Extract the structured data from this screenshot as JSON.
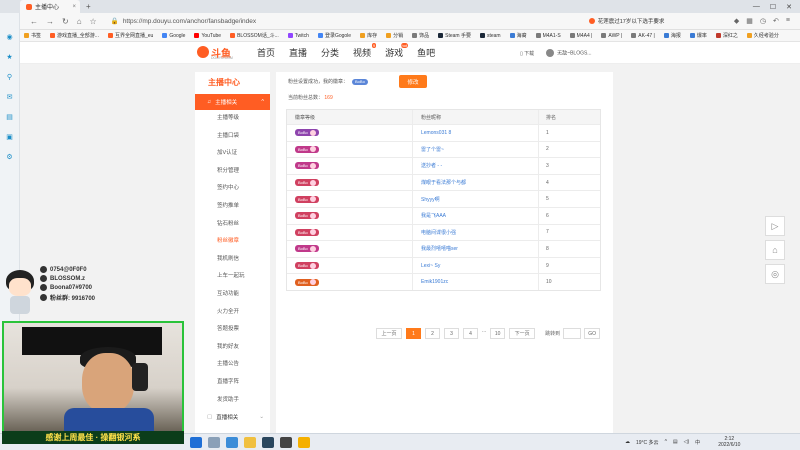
{
  "browser": {
    "tab_title": "主播中心",
    "url": "https://mp.douyu.com/anchor/fansbadge/index",
    "hot_text": "花莲震过17岁以下选手要求",
    "bookmarks": [
      {
        "label": "书签",
        "color": "#f0a020"
      },
      {
        "label": "游戏直播_全部游...",
        "color": "#ff5d23"
      },
      {
        "label": "互界全网直播_eu",
        "color": "#ff5d23"
      },
      {
        "label": "Google",
        "color": "#4285f4"
      },
      {
        "label": "YouTube",
        "color": "#ff0000"
      },
      {
        "label": "BLOSSOM话_斗...",
        "color": "#ff5d23"
      },
      {
        "label": "Twitch",
        "color": "#9146ff"
      },
      {
        "label": "登录Gogole",
        "color": "#4285f4"
      },
      {
        "label": "库存",
        "color": "#f0a020"
      },
      {
        "label": "分销",
        "color": "#f0a020"
      },
      {
        "label": "饰品",
        "color": "#7a7a7a"
      },
      {
        "label": "Steam 手要",
        "color": "#1b2838"
      },
      {
        "label": "steam",
        "color": "#1b2838"
      },
      {
        "label": "海裔",
        "color": "#3a7bd5"
      },
      {
        "label": "M4A1-S",
        "color": "#7a7a7a"
      },
      {
        "label": "M4A4 |",
        "color": "#7a7a7a"
      },
      {
        "label": "AWP |",
        "color": "#7a7a7a"
      },
      {
        "label": "AK-47 |",
        "color": "#7a7a7a"
      },
      {
        "label": "海报",
        "color": "#3a7bd5"
      },
      {
        "label": "爆率",
        "color": "#3a7bd5"
      },
      {
        "label": "深红之",
        "color": "#c0392b"
      },
      {
        "label": "久经考验分",
        "color": "#f0a020"
      }
    ]
  },
  "site": {
    "logo_text": "斗鱼",
    "logo_sub": "DOUYU.COM",
    "nav": [
      {
        "label": "首页",
        "badge": ""
      },
      {
        "label": "直播",
        "badge": ""
      },
      {
        "label": "分类",
        "badge": ""
      },
      {
        "label": "视频",
        "badge": "9"
      },
      {
        "label": "游戏",
        "badge": "hot"
      },
      {
        "label": "鱼吧",
        "badge": ""
      }
    ],
    "download": "下载",
    "user_name": "无敌~BLOGS..."
  },
  "sidebar": {
    "title": "主播中心",
    "active_group": "主播相关",
    "items": [
      "主播等级",
      "主播口袋",
      "加V认证",
      "积分管理",
      "签约中心",
      "签约推单",
      "钻石粉丝",
      "粉丝徽章",
      "我机刷信",
      "上车一起玩",
      "互动功能",
      "火力全开",
      "答题投票",
      "我的好友",
      "主播公告",
      "直播字阵",
      "发货助手"
    ],
    "current_index": 7,
    "group2": "直播相关"
  },
  "content": {
    "badge_prefix": "粉丝设置成功，我的徽章：",
    "my_badge": "BoBo",
    "edit_button": "修改",
    "fan_total_label": "当前粉丝总数：",
    "fan_total": "169",
    "table": {
      "headers": [
        "徽章等级",
        "粉丝昵称",
        "排名"
      ],
      "rows": [
        {
          "badge": "BoBo",
          "level": 23,
          "color": "#8e44ad",
          "name": "Lemons031 8",
          "rank": "1"
        },
        {
          "badge": "BoBo",
          "level": 21,
          "color": "#c0398a",
          "name": "雷了个雷~",
          "rank": "2"
        },
        {
          "badge": "BoBo",
          "level": 19,
          "color": "#c0398a",
          "name": "送抄者 - -",
          "rank": "3"
        },
        {
          "badge": "BoBo",
          "level": 18,
          "color": "#d04060",
          "name": "煤眼于看法那个与都",
          "rank": "4"
        },
        {
          "badge": "BoBo",
          "level": 16,
          "color": "#d04060",
          "name": "Shyyy啊",
          "rank": "5"
        },
        {
          "badge": "BoBo",
          "level": 15,
          "color": "#d04060",
          "name": "我是飞AAA",
          "rank": "6"
        },
        {
          "badge": "BoBo",
          "level": 15,
          "color": "#d04060",
          "name": "电脑间谍很小强",
          "rank": "7"
        },
        {
          "badge": "BoBo",
          "level": 15,
          "color": "#c0398a",
          "name": "我最烈嘻嘻喵ser",
          "rank": "8"
        },
        {
          "badge": "BoBo",
          "level": 14,
          "color": "#d04060",
          "name": "Lexi~ Sy",
          "rank": "9"
        },
        {
          "badge": "BoBo",
          "level": 14,
          "color": "#e06020",
          "name": "Emik1901zc",
          "rank": "10"
        }
      ]
    },
    "pager": {
      "prev": "上一页",
      "pages": [
        "1",
        "2",
        "3",
        "4",
        "...",
        "10"
      ],
      "next": "下一页",
      "jump_label": "跳转到",
      "go": "GO"
    }
  },
  "overlay": {
    "lines": [
      "0754@0F0F0",
      "BLOSSOM.z",
      "Boona07#9700",
      "粉丝群: 9916700"
    ],
    "banner": "感谢上周最佳 · 操翻银河系"
  },
  "taskbar": {
    "weather": "19°C 多云",
    "time": "2:12",
    "date": "2022/6/10"
  }
}
